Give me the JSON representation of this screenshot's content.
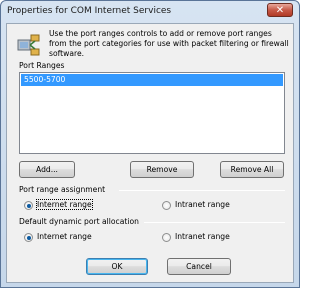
{
  "window": {
    "title": "Properties for COM Internet Services",
    "close_glyph": "✕"
  },
  "description": "Use the port ranges controls to add or remove port ranges from the port categories for use with packet filtering or firewall software.",
  "port_ranges": {
    "label": "Port Ranges",
    "items": [
      "5500-5700"
    ],
    "selected_index": 0
  },
  "buttons": {
    "add": "Add...",
    "remove": "Remove",
    "remove_all": "Remove All",
    "ok": "OK",
    "cancel": "Cancel"
  },
  "assignment": {
    "title": "Port range assignment",
    "internet": "Internet range",
    "intranet": "Intranet range",
    "selected": "internet"
  },
  "allocation": {
    "title": "Default dynamic port allocation",
    "internet": "Internet range",
    "intranet": "Intranet range",
    "selected": "internet"
  },
  "colors": {
    "selection": "#3399ff",
    "titlebar": "#d7e4f2",
    "close": "#c75a48"
  },
  "icons": {
    "app": "network-ports-icon",
    "close": "close-icon"
  }
}
